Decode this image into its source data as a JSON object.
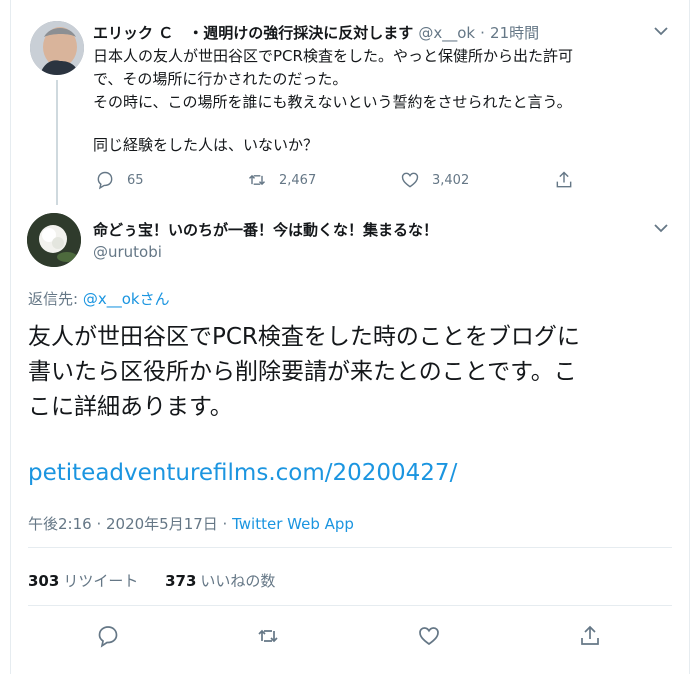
{
  "parent_tweet": {
    "display_name": "エリック Ｃ　・週明けの強行採決に反対します",
    "handle": "@x__ok",
    "time": "21時間",
    "lines": [
      "日本人の友人が世田谷区でPCR検査をした。やっと保健所から出た許可",
      "で、その場所に行かされたのだった。",
      "その時に、この場所を誰にも教えないという誓約をさせられたと言う。"
    ],
    "question": "同じ経験をした人は、いないか？",
    "replies": "65",
    "retweets": "2,467",
    "likes": "3,402"
  },
  "main_tweet": {
    "display_name": "命どぅ宝！いのちが一番！今は動くな！集まるな！",
    "handle": "@urutobi",
    "reply_prefix": "返信先: ",
    "reply_to": "@x__ok",
    "reply_suffix": "さん",
    "text_lines": [
      "友人が世田谷区でPCR検査をした時のことをブログに",
      "書いたら区役所から削除要請が来たとのことです。こ",
      "こに詳細あります。"
    ],
    "link": "petiteadventurefilms.com/20200427/",
    "timestamp": "午後2:16 · 2020年5月17日 · ",
    "app": "Twitter Web App",
    "retweet_count": "303",
    "retweet_label": "リツイート",
    "like_count": "373",
    "like_label": "いいねの数"
  },
  "icons": [
    "avatar",
    "chevron-down-icon",
    "reply-icon",
    "retweet-icon",
    "like-icon",
    "share-icon"
  ],
  "colors": {
    "link": "#1b95e0",
    "muted": "#657786",
    "text": "#14171a",
    "divider": "#e6ecf0"
  }
}
